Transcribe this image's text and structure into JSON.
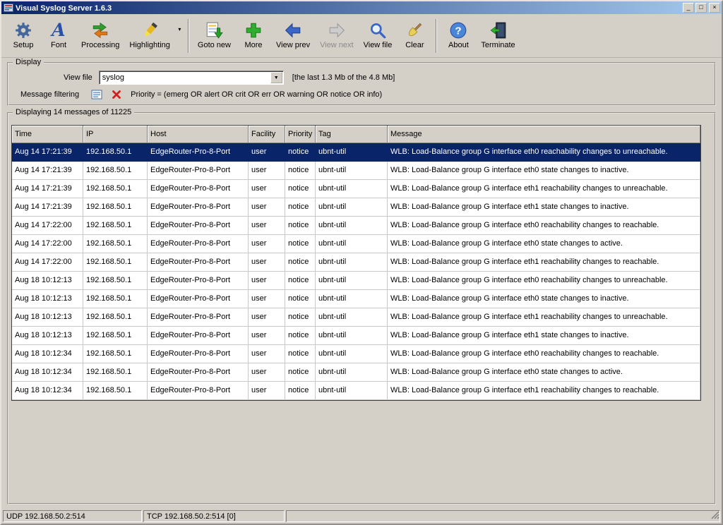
{
  "window": {
    "title": "Visual Syslog Server 1.6.3",
    "controls": {
      "minimize": "_",
      "maximize": "□",
      "close": "×"
    }
  },
  "colors": {
    "titlebar_start": "#0a246a",
    "titlebar_end": "#a6caf0",
    "selection_bg": "#0a246a",
    "window_bg": "#d4d0c8"
  },
  "toolbar": {
    "buttons": [
      {
        "label": "Setup"
      },
      {
        "label": "Font"
      },
      {
        "label": "Processing"
      },
      {
        "label": "Highlighting"
      },
      {
        "label": "Goto new"
      },
      {
        "label": "More"
      },
      {
        "label": "View prev"
      },
      {
        "label": "View next",
        "disabled": true
      },
      {
        "label": "View file"
      },
      {
        "label": "Clear"
      },
      {
        "label": "About"
      },
      {
        "label": "Terminate"
      }
    ]
  },
  "display_group": {
    "title": "Display",
    "view_file_label": "View file",
    "view_file_value": "syslog",
    "size_info": "[the last 1.3 Mb of the 4.8 Mb]",
    "filtering_label": "Message filtering",
    "priority_text": "Priority = (emerg OR alert OR crit OR err OR warning OR notice OR info)"
  },
  "messages_group": {
    "title": "Displaying 14 messages of 11225",
    "columns": [
      "Time",
      "IP",
      "Host",
      "Facility",
      "Priority",
      "Tag",
      "Message"
    ],
    "selected_row": 0,
    "rows": [
      {
        "time": "Aug 14 17:21:39",
        "ip": "192.168.50.1",
        "host": "EdgeRouter-Pro-8-Port",
        "facility": "user",
        "priority": "notice",
        "tag": "ubnt-util",
        "message": "WLB: Load-Balance group G interface eth0 reachability changes to unreachable."
      },
      {
        "time": "Aug 14 17:21:39",
        "ip": "192.168.50.1",
        "host": "EdgeRouter-Pro-8-Port",
        "facility": "user",
        "priority": "notice",
        "tag": "ubnt-util",
        "message": "WLB: Load-Balance group G interface eth0 state changes to inactive."
      },
      {
        "time": "Aug 14 17:21:39",
        "ip": "192.168.50.1",
        "host": "EdgeRouter-Pro-8-Port",
        "facility": "user",
        "priority": "notice",
        "tag": "ubnt-util",
        "message": "WLB: Load-Balance group G interface eth1 reachability changes to unreachable."
      },
      {
        "time": "Aug 14 17:21:39",
        "ip": "192.168.50.1",
        "host": "EdgeRouter-Pro-8-Port",
        "facility": "user",
        "priority": "notice",
        "tag": "ubnt-util",
        "message": "WLB: Load-Balance group G interface eth1 state changes to inactive."
      },
      {
        "time": "Aug 14 17:22:00",
        "ip": "192.168.50.1",
        "host": "EdgeRouter-Pro-8-Port",
        "facility": "user",
        "priority": "notice",
        "tag": "ubnt-util",
        "message": "WLB: Load-Balance group G interface eth0 reachability changes to reachable."
      },
      {
        "time": "Aug 14 17:22:00",
        "ip": "192.168.50.1",
        "host": "EdgeRouter-Pro-8-Port",
        "facility": "user",
        "priority": "notice",
        "tag": "ubnt-util",
        "message": "WLB: Load-Balance group G interface eth0 state changes to active."
      },
      {
        "time": "Aug 14 17:22:00",
        "ip": "192.168.50.1",
        "host": "EdgeRouter-Pro-8-Port",
        "facility": "user",
        "priority": "notice",
        "tag": "ubnt-util",
        "message": "WLB: Load-Balance group G interface eth1 reachability changes to reachable."
      },
      {
        "time": "Aug 18 10:12:13",
        "ip": "192.168.50.1",
        "host": "EdgeRouter-Pro-8-Port",
        "facility": "user",
        "priority": "notice",
        "tag": "ubnt-util",
        "message": "WLB: Load-Balance group G interface eth0 reachability changes to unreachable."
      },
      {
        "time": "Aug 18 10:12:13",
        "ip": "192.168.50.1",
        "host": "EdgeRouter-Pro-8-Port",
        "facility": "user",
        "priority": "notice",
        "tag": "ubnt-util",
        "message": "WLB: Load-Balance group G interface eth0 state changes to inactive."
      },
      {
        "time": "Aug 18 10:12:13",
        "ip": "192.168.50.1",
        "host": "EdgeRouter-Pro-8-Port",
        "facility": "user",
        "priority": "notice",
        "tag": "ubnt-util",
        "message": "WLB: Load-Balance group G interface eth1 reachability changes to unreachable."
      },
      {
        "time": "Aug 18 10:12:13",
        "ip": "192.168.50.1",
        "host": "EdgeRouter-Pro-8-Port",
        "facility": "user",
        "priority": "notice",
        "tag": "ubnt-util",
        "message": "WLB: Load-Balance group G interface eth1 state changes to inactive."
      },
      {
        "time": "Aug 18 10:12:34",
        "ip": "192.168.50.1",
        "host": "EdgeRouter-Pro-8-Port",
        "facility": "user",
        "priority": "notice",
        "tag": "ubnt-util",
        "message": "WLB: Load-Balance group G interface eth0 reachability changes to reachable."
      },
      {
        "time": "Aug 18 10:12:34",
        "ip": "192.168.50.1",
        "host": "EdgeRouter-Pro-8-Port",
        "facility": "user",
        "priority": "notice",
        "tag": "ubnt-util",
        "message": "WLB: Load-Balance group G interface eth0 state changes to active."
      },
      {
        "time": "Aug 18 10:12:34",
        "ip": "192.168.50.1",
        "host": "EdgeRouter-Pro-8-Port",
        "facility": "user",
        "priority": "notice",
        "tag": "ubnt-util",
        "message": "WLB: Load-Balance group G interface eth1 reachability changes to reachable."
      }
    ]
  },
  "statusbar": {
    "udp": "UDP 192.168.50.2:514",
    "tcp": "TCP 192.168.50.2:514 [0]"
  }
}
